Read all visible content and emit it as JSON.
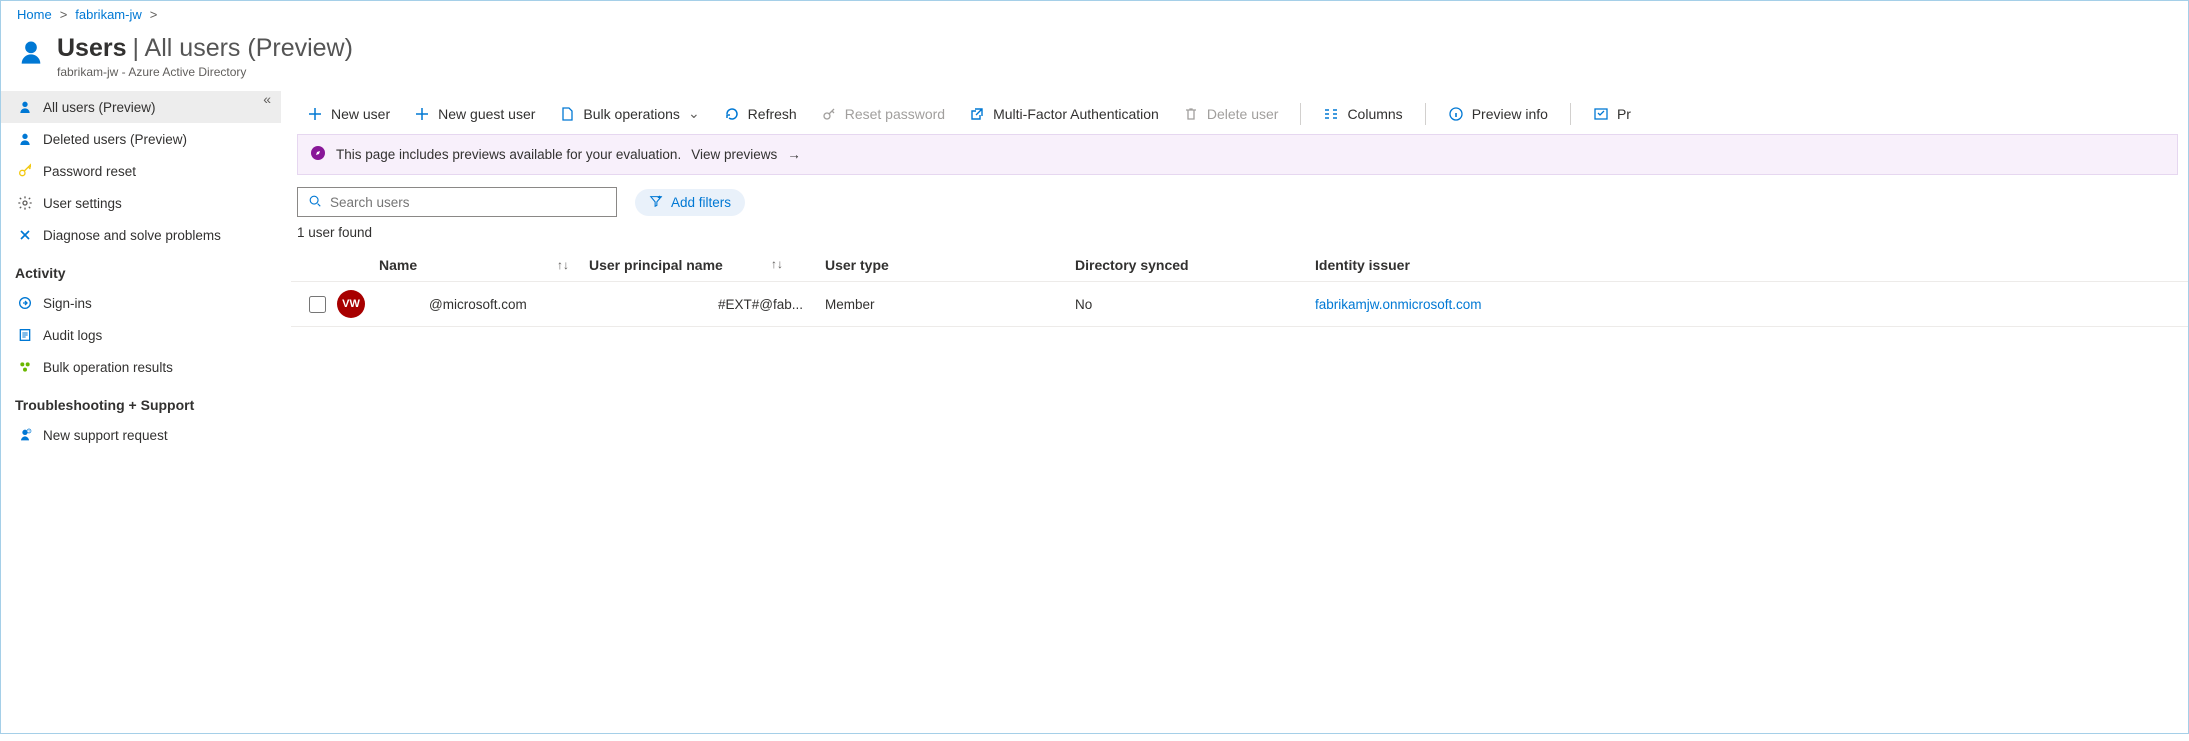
{
  "breadcrumb": {
    "home": "Home",
    "org": "fabrikam-jw"
  },
  "header": {
    "title_strong": "Users",
    "title_rest": "| All users (Preview)",
    "subtitle": "fabrikam-jw - Azure Active Directory"
  },
  "sidebar": {
    "items": [
      {
        "label": "All users (Preview)"
      },
      {
        "label": "Deleted users (Preview)"
      },
      {
        "label": "Password reset"
      },
      {
        "label": "User settings"
      },
      {
        "label": "Diagnose and solve problems"
      }
    ],
    "section_activity": "Activity",
    "activity": [
      {
        "label": "Sign-ins"
      },
      {
        "label": "Audit logs"
      },
      {
        "label": "Bulk operation results"
      }
    ],
    "section_support": "Troubleshooting + Support",
    "support": [
      {
        "label": "New support request"
      }
    ]
  },
  "toolbar": {
    "new_user": "New user",
    "new_guest": "New guest user",
    "bulk_ops": "Bulk operations",
    "refresh": "Refresh",
    "reset_pw": "Reset password",
    "mfa": "Multi-Factor Authentication",
    "delete": "Delete user",
    "columns": "Columns",
    "preview_info": "Preview info",
    "preview_feat": "Pr"
  },
  "banner": {
    "text": "This page includes previews available for your evaluation.",
    "link": "View previews"
  },
  "search": {
    "placeholder": "Search users"
  },
  "add_filters": "Add filters",
  "count_text": "1 user found",
  "columns": {
    "name": "Name",
    "upn": "User principal name",
    "type": "User type",
    "sync": "Directory synced",
    "issuer": "Identity issuer"
  },
  "rows": [
    {
      "avatar_initials": "VW",
      "name": "@microsoft.com",
      "upn": "#EXT#@fab...",
      "type": "Member",
      "sync": "No",
      "issuer": "fabrikamjw.onmicrosoft.com"
    }
  ]
}
